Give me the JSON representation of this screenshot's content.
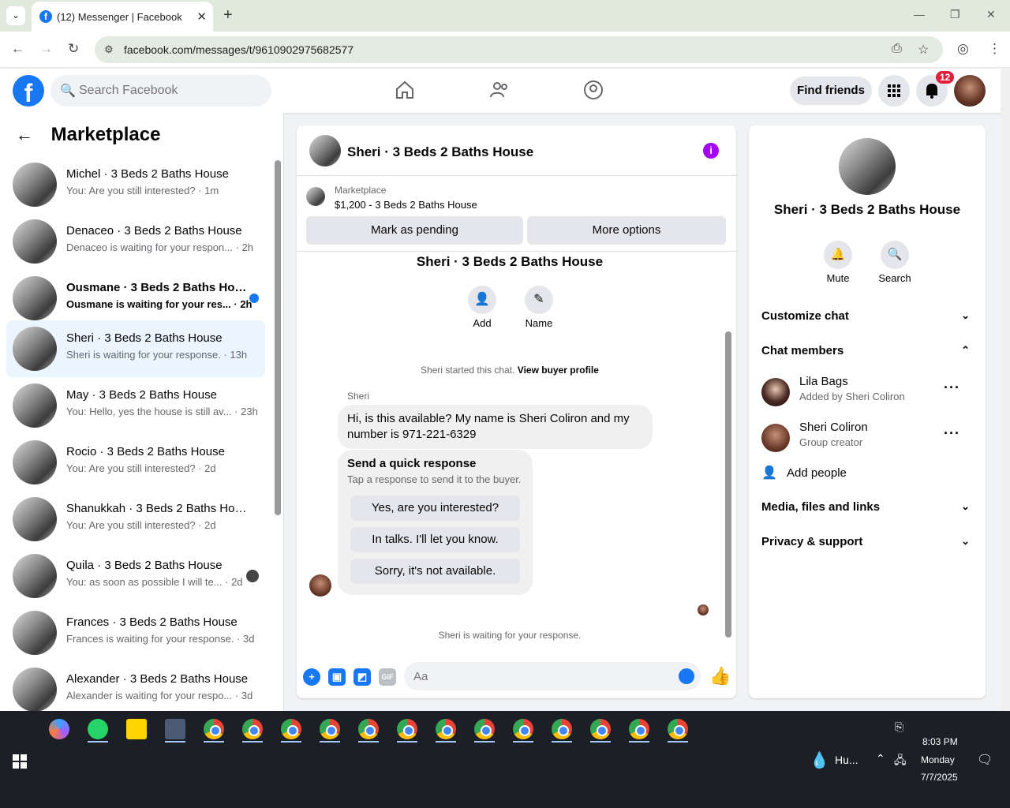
{
  "browser": {
    "tab_title": "(12) Messenger | Facebook",
    "url": "facebook.com/messages/t/9610902975682577"
  },
  "fb": {
    "search_placeholder": "Search Facebook",
    "find_friends": "Find friends",
    "notif_count": "12"
  },
  "left": {
    "title": "Marketplace",
    "conversations": [
      {
        "name": "Michel · 3 Beds 2 Baths House",
        "preview": "You: Are you still interested? · 1m"
      },
      {
        "name": "Denaceo · 3 Beds 2 Baths House",
        "preview": "Denaceo is waiting for your respon... · 2h"
      },
      {
        "name": "Ousmane · 3 Beds 2 Baths Hou...",
        "preview": "Ousmane is waiting for your res... · 2h"
      },
      {
        "name": "Sheri · 3 Beds 2 Baths House",
        "preview": "Sheri is waiting for your response. · 13h"
      },
      {
        "name": "May · 3 Beds 2 Baths House",
        "preview": "You: Hello, yes the house is still av... · 23h"
      },
      {
        "name": "Rocio · 3 Beds 2 Baths House",
        "preview": "You: Are you still interested? · 2d"
      },
      {
        "name": "Shanukkah · 3 Beds 2 Baths House",
        "preview": "You: Are you still interested? · 2d"
      },
      {
        "name": "Quila · 3 Beds 2 Baths House",
        "preview": "You: as soon as possible I will te... · 2d"
      },
      {
        "name": "Frances · 3 Beds 2 Baths House",
        "preview": "Frances is waiting for your response. · 3d"
      },
      {
        "name": "Alexander · 3 Beds 2 Baths House",
        "preview": "Alexander is waiting for your respo... · 3d"
      }
    ]
  },
  "chat": {
    "title": "Sheri · 3 Beds 2 Baths House",
    "marketplace_label": "Marketplace",
    "listing": "$1,200 - 3 Beds 2 Baths House",
    "mark_pending": "Mark as pending",
    "more_options": "More options",
    "strip_title": "Sheri · 3 Beds 2 Baths House",
    "add_label": "Add",
    "name_label": "Name",
    "started": "Sheri started this chat.",
    "view_profile": "View buyer profile",
    "sender": "Sheri",
    "message": "Hi, is this available? My name is Sheri Coliron and my number is 971-221-6329",
    "quick_title": "Send a quick response",
    "quick_sub": "Tap a response to send it to the buyer.",
    "quick_options": [
      "Yes, are you interested?",
      "In talks. I'll let you know.",
      "Sorry, it's not available."
    ],
    "waiting": "Sheri is waiting for your response.",
    "input_placeholder": "Aa"
  },
  "right": {
    "title": "Sheri · 3 Beds 2 Baths House",
    "mute": "Mute",
    "search": "Search",
    "customize": "Customize chat",
    "members": "Chat members",
    "member_list": [
      {
        "name": "Lila Bags",
        "sub": "Added by Sheri Coliron"
      },
      {
        "name": "Sheri Coliron",
        "sub": "Group creator"
      }
    ],
    "add_people": "Add people",
    "media": "Media, files and links",
    "privacy": "Privacy & support"
  },
  "taskbar": {
    "weather": "Hu...",
    "time": "8:03 PM",
    "day": "Monday",
    "date": "7/7/2025"
  }
}
